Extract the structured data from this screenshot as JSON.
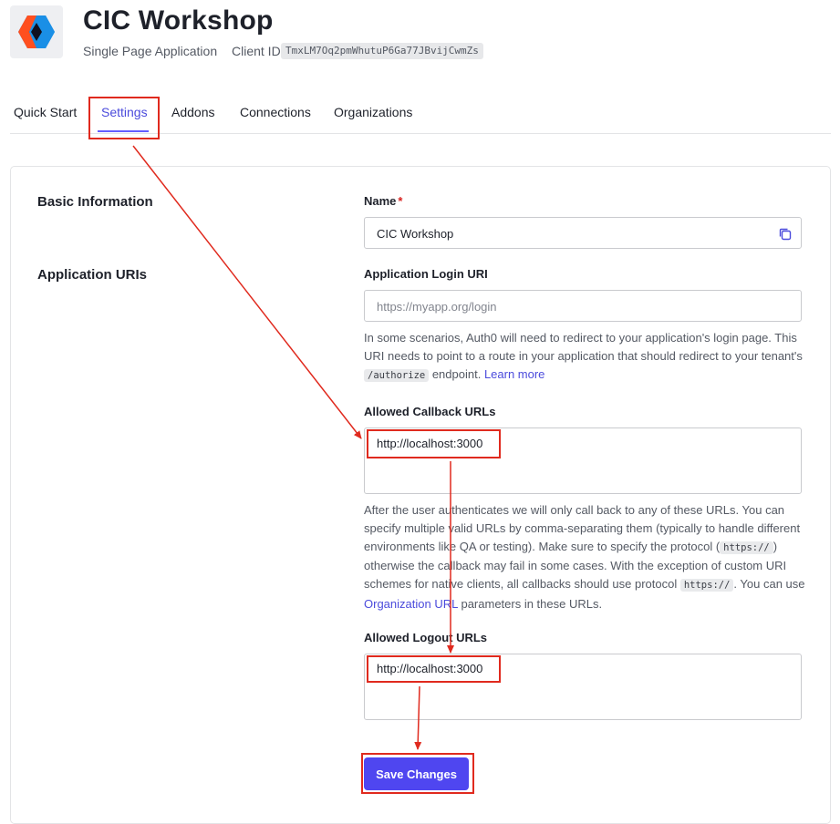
{
  "header": {
    "title": "CIC Workshop",
    "app_type": "Single Page Application",
    "client_id_label": "Client ID",
    "client_id_value": "TmxLM7Oq2pmWhutuP6Ga77JBvijCwmZs",
    "logo_icon": "auth0-logo-icon"
  },
  "tabs": [
    {
      "label": "Quick Start"
    },
    {
      "label": "Settings",
      "active": true
    },
    {
      "label": "Addons"
    },
    {
      "label": "Connections"
    },
    {
      "label": "Organizations"
    }
  ],
  "sections": {
    "basic_information": "Basic Information",
    "application_uris": "Application URIs"
  },
  "name_field": {
    "label": "Name",
    "required_mark": "*",
    "value": "CIC Workshop",
    "icon": "copy-icon"
  },
  "login_uri": {
    "label": "Application Login URI",
    "placeholder": "https://myapp.org/login",
    "help_1": "In some scenarios, Auth0 will need to redirect to your application's login page. This URI needs to point to a route in your application that should redirect to your tenant's ",
    "help_code": "/authorize",
    "help_2": " endpoint. ",
    "help_link": "Learn more"
  },
  "callback_urls": {
    "label": "Allowed Callback URLs",
    "value": "http://localhost:3000",
    "help_1": "After the user authenticates we will only call back to any of these URLs. You can specify multiple valid URLs by comma-separating them (typically to handle different environments like QA or testing). Make sure to specify the protocol (",
    "help_code_1": "https://",
    "help_2": ") otherwise the callback may fail in some cases. With the exception of custom URI schemes for native clients, all callbacks should use protocol ",
    "help_code_2": "https://",
    "help_3": ". You can use ",
    "help_link": "Organization URL",
    "help_4": " parameters in these URLs."
  },
  "logout_urls": {
    "label": "Allowed Logout URLs",
    "value": "http://localhost:3000"
  },
  "save_button": "Save Changes",
  "colors": {
    "accent": "#635dff",
    "button": "#4f46f0",
    "annotation": "#e02a1e"
  }
}
